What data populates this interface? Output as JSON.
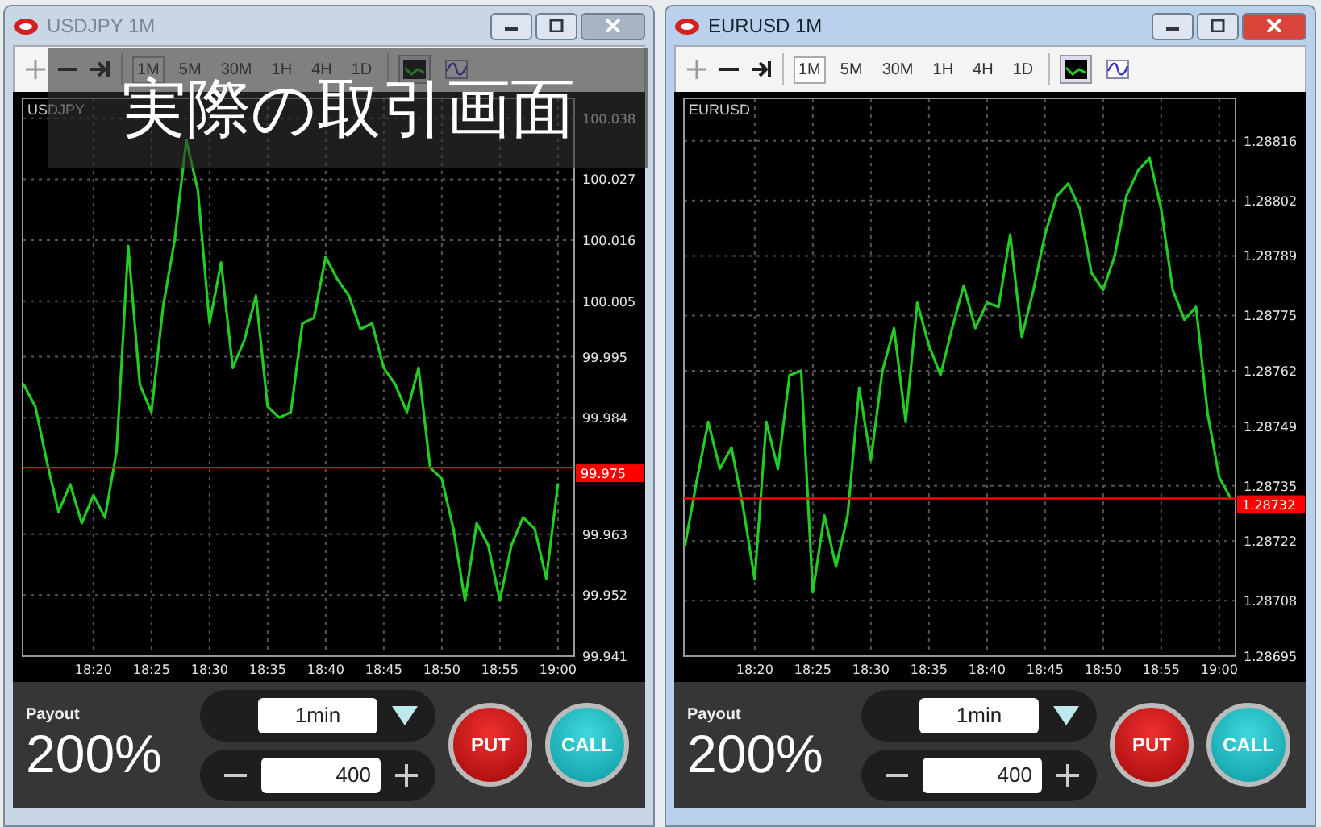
{
  "caption": "実際の取引画面",
  "windows": [
    {
      "title": "USDJPY 1M",
      "active": false,
      "timeframes": [
        {
          "label": "1M",
          "selected": true
        },
        {
          "label": "5M",
          "selected": false
        },
        {
          "label": "30M",
          "selected": false
        },
        {
          "label": "1H",
          "selected": false
        },
        {
          "label": "4H",
          "selected": false
        },
        {
          "label": "1D",
          "selected": false
        }
      ],
      "chart_styles": [
        {
          "selected": true
        },
        {
          "selected": false
        }
      ],
      "chart_data": {
        "type": "line",
        "title": "USDJPY",
        "categories": [
          null,
          null,
          null,
          null,
          null,
          null,
          "18:20",
          null,
          null,
          null,
          null,
          "18:25",
          null,
          null,
          null,
          null,
          "18:30",
          null,
          null,
          null,
          null,
          "18:35",
          null,
          null,
          null,
          null,
          "18:40",
          null,
          null,
          null,
          null,
          "18:45",
          null,
          null,
          null,
          null,
          "18:50",
          null,
          null,
          null,
          null,
          "18:55",
          null,
          null,
          null,
          null,
          "19:00"
        ],
        "series": [
          {
            "color": "#22cc22",
            "values": [
              99.99,
              99.986,
              99.976,
              99.967,
              99.972,
              99.965,
              99.97,
              99.966,
              99.978,
              100.015,
              99.99,
              99.985,
              100.004,
              100.016,
              100.034,
              100.025,
              100.001,
              100.012,
              99.993,
              99.998,
              100.006,
              99.986,
              99.984,
              99.985,
              100.001,
              100.002,
              100.013,
              100.009,
              100.006,
              100.0,
              100.001,
              99.993,
              99.99,
              99.985,
              99.993,
              99.975,
              99.973,
              99.964,
              99.951,
              99.965,
              99.961,
              99.951,
              99.961,
              99.966,
              99.964,
              99.955,
              99.972
            ]
          }
        ],
        "ylim": [
          99.941,
          100.0416
        ],
        "yticks": [
          100.038,
          100.027,
          100.016,
          100.005,
          99.995,
          99.984,
          99.963,
          99.952,
          99.941
        ],
        "grid": true,
        "ref_lines": [
          {
            "axis": "y",
            "value": 99.975,
            "label": "99.975",
            "color": "#ff0000"
          }
        ]
      },
      "trade": {
        "payout_label": "Payout",
        "payout": "200%",
        "expiry": "1min",
        "amount": "400",
        "put": "PUT",
        "call": "CALL"
      }
    },
    {
      "title": "EURUSD 1M",
      "active": true,
      "timeframes": [
        {
          "label": "1M",
          "selected": true
        },
        {
          "label": "5M",
          "selected": false
        },
        {
          "label": "30M",
          "selected": false
        },
        {
          "label": "1H",
          "selected": false
        },
        {
          "label": "4H",
          "selected": false
        },
        {
          "label": "1D",
          "selected": false
        }
      ],
      "chart_styles": [
        {
          "selected": true
        },
        {
          "selected": false
        }
      ],
      "chart_data": {
        "type": "line",
        "title": "EURUSD",
        "categories": [
          null,
          null,
          null,
          null,
          null,
          null,
          "18:20",
          null,
          null,
          null,
          null,
          "18:25",
          null,
          null,
          null,
          null,
          "18:30",
          null,
          null,
          null,
          null,
          "18:35",
          null,
          null,
          null,
          null,
          "18:40",
          null,
          null,
          null,
          null,
          "18:45",
          null,
          null,
          null,
          null,
          "18:50",
          null,
          null,
          null,
          null,
          "18:55",
          null,
          null,
          null,
          null,
          "19:00",
          null
        ],
        "series": [
          {
            "color": "#22cc22",
            "values": [
              1.28721,
              1.28736,
              1.2875,
              1.28739,
              1.28744,
              1.2873,
              1.28713,
              1.2875,
              1.28739,
              1.28761,
              1.28762,
              1.2871,
              1.28728,
              1.28716,
              1.28728,
              1.28758,
              1.28741,
              1.28762,
              1.28772,
              1.2875,
              1.28778,
              1.28768,
              1.28761,
              1.28772,
              1.28782,
              1.28772,
              1.28778,
              1.28777,
              1.28794,
              1.2877,
              1.28781,
              1.28794,
              1.28803,
              1.28806,
              1.288,
              1.28785,
              1.28781,
              1.28789,
              1.28803,
              1.28809,
              1.28812,
              1.288,
              1.28781,
              1.28774,
              1.28777,
              1.28752,
              1.28737,
              1.28732
            ]
          }
        ],
        "ylim": [
          1.28695,
          1.28826
        ],
        "yticks": [
          1.28816,
          1.28802,
          1.28789,
          1.28775,
          1.28762,
          1.28749,
          1.28735,
          1.28722,
          1.28708,
          1.28695
        ],
        "grid": true,
        "ref_lines": [
          {
            "axis": "y",
            "value": 1.28732,
            "label": "1.28732",
            "color": "#ff0000"
          }
        ]
      },
      "trade": {
        "payout_label": "Payout",
        "payout": "200%",
        "expiry": "1min",
        "amount": "400",
        "put": "PUT",
        "call": "CALL"
      }
    }
  ]
}
